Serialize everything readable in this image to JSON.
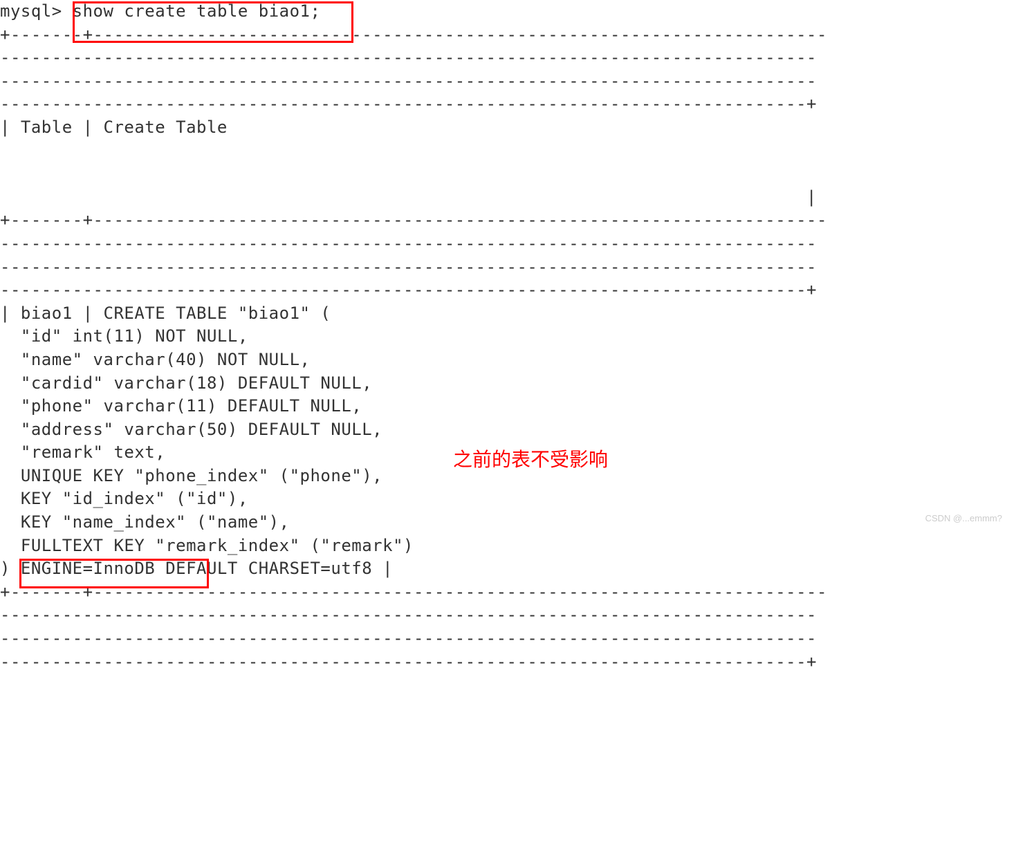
{
  "prompt": "mysql> ",
  "command": "show create table biao1;",
  "sep1": "+-------+-----------------------------------------------------------------------",
  "sep2": "-------------------------------------------------------------------------------",
  "sep3": "------------------------------------------------------------------------------+",
  "header": "| Table | Create Table",
  "header_space": "",
  "header_bar": "                                                                              |",
  "row_start": "| biao1 | CREATE TABLE \"biao1\" (",
  "col_id": "  \"id\" int(11) NOT NULL,",
  "col_name": "  \"name\" varchar(40) NOT NULL,",
  "col_cardid": "  \"cardid\" varchar(18) DEFAULT NULL,",
  "col_phone": "  \"phone\" varchar(11) DEFAULT NULL,",
  "col_address": "  \"address\" varchar(50) DEFAULT NULL,",
  "col_remark": "  \"remark\" text,",
  "key_unique": "  UNIQUE KEY \"phone_index\" (\"phone\"),",
  "key_id": "  KEY \"id_index\" (\"id\"),",
  "key_name": "  KEY \"name_index\" (\"name\"),",
  "key_fulltext": "  FULLTEXT KEY \"remark_index\" (\"remark\")",
  "engine_line": ") ENGINE=InnoDB DEFAULT CHARSET=utf8 |",
  "annotation": "之前的表不受影响",
  "watermark": "CSDN @...emmm?"
}
